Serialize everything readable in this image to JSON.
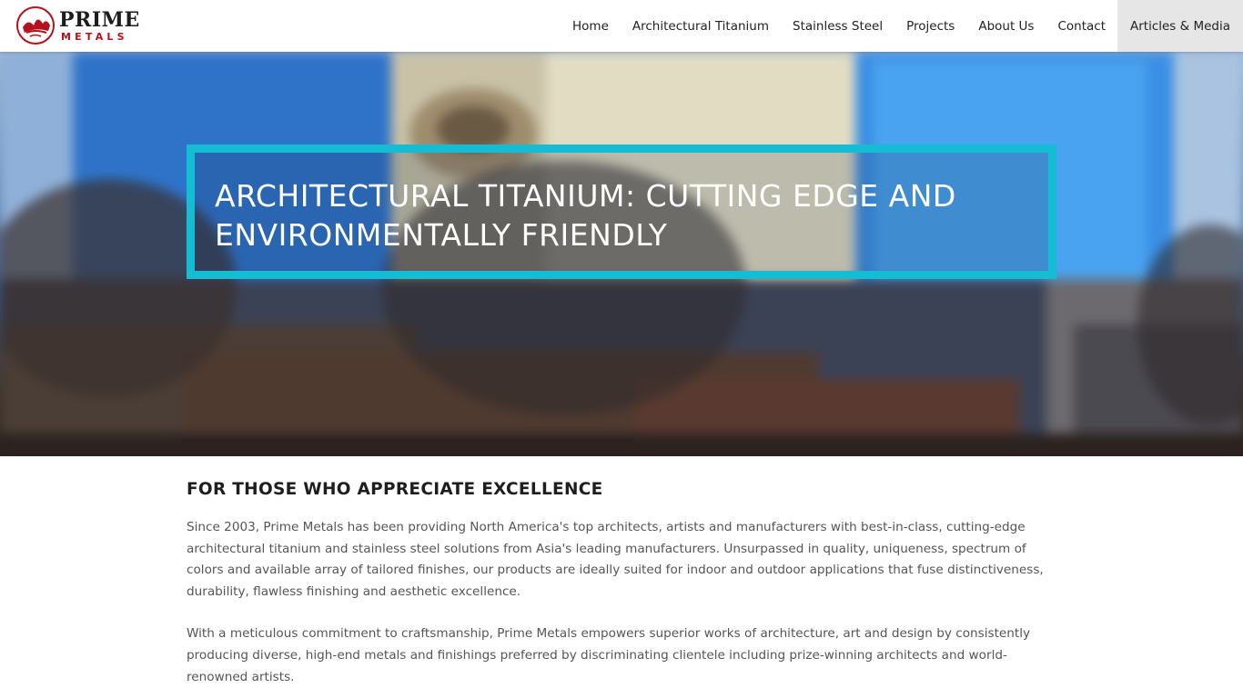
{
  "brand": {
    "name_top": "PRIME",
    "name_bottom": "METALS",
    "colors": {
      "red": "#b5121b",
      "dark": "#1d1d1d"
    },
    "logo_icon": "crown-emblem-icon"
  },
  "nav": {
    "items": [
      {
        "label": "Home",
        "active": false
      },
      {
        "label": "Architectural Titanium",
        "active": false
      },
      {
        "label": "Stainless Steel",
        "active": false
      },
      {
        "label": "Projects",
        "active": false
      },
      {
        "label": "About Us",
        "active": false
      },
      {
        "label": "Contact",
        "active": false
      },
      {
        "label": "Articles & Media",
        "active": true
      }
    ]
  },
  "hero": {
    "title": "Architectural Titanium: Cutting Edge and Environmentally Friendly",
    "frame_color": "#14bdd4"
  },
  "main": {
    "heading": "For Those Who Appreciate Excellence",
    "paragraphs": [
      "Since 2003, Prime Metals has been providing North America's top architects, artists and manufacturers with best-in-class, cutting-edge architectural titanium and stainless steel solutions from Asia's leading manufacturers. Unsurpassed in quality, uniqueness, spectrum of colors and available array of tailored finishes, our products are ideally suited for indoor and outdoor applications that fuse distinctiveness, durability, flawless finishing and aesthetic excellence.",
      "With a meticulous commitment to craftsmanship, Prime Metals empowers superior works of architecture, art and design by consistently producing diverse, high-end metals and finishings preferred by discriminating clientele including prize-winning architects and world-renowned artists."
    ]
  }
}
